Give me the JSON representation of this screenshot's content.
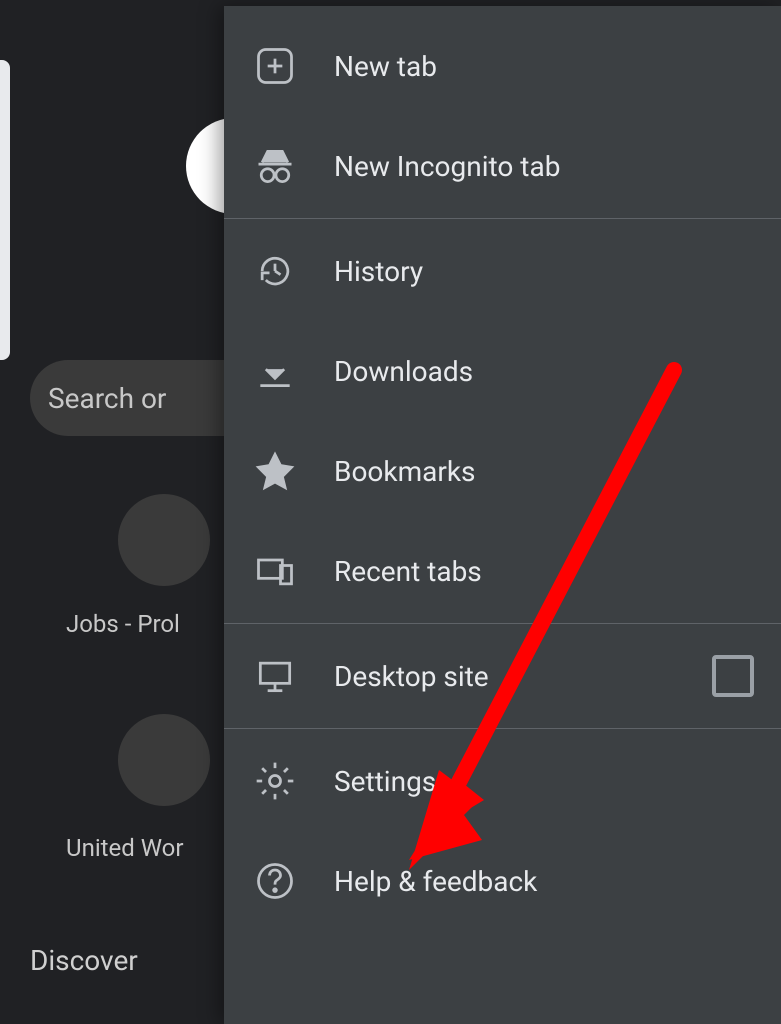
{
  "background": {
    "search_placeholder": "Search or ",
    "tiles": [
      {
        "label": "Jobs - Prol"
      },
      {
        "label": "United Wor"
      }
    ],
    "discover_label": "Discover"
  },
  "menu": {
    "items": [
      {
        "label": "New tab"
      },
      {
        "label": "New Incognito tab"
      },
      {
        "label": "History"
      },
      {
        "label": "Downloads"
      },
      {
        "label": "Bookmarks"
      },
      {
        "label": "Recent tabs"
      },
      {
        "label": "Desktop site"
      },
      {
        "label": "Settings"
      },
      {
        "label": "Help & feedback"
      }
    ]
  },
  "annotation": {
    "target": "Settings"
  }
}
